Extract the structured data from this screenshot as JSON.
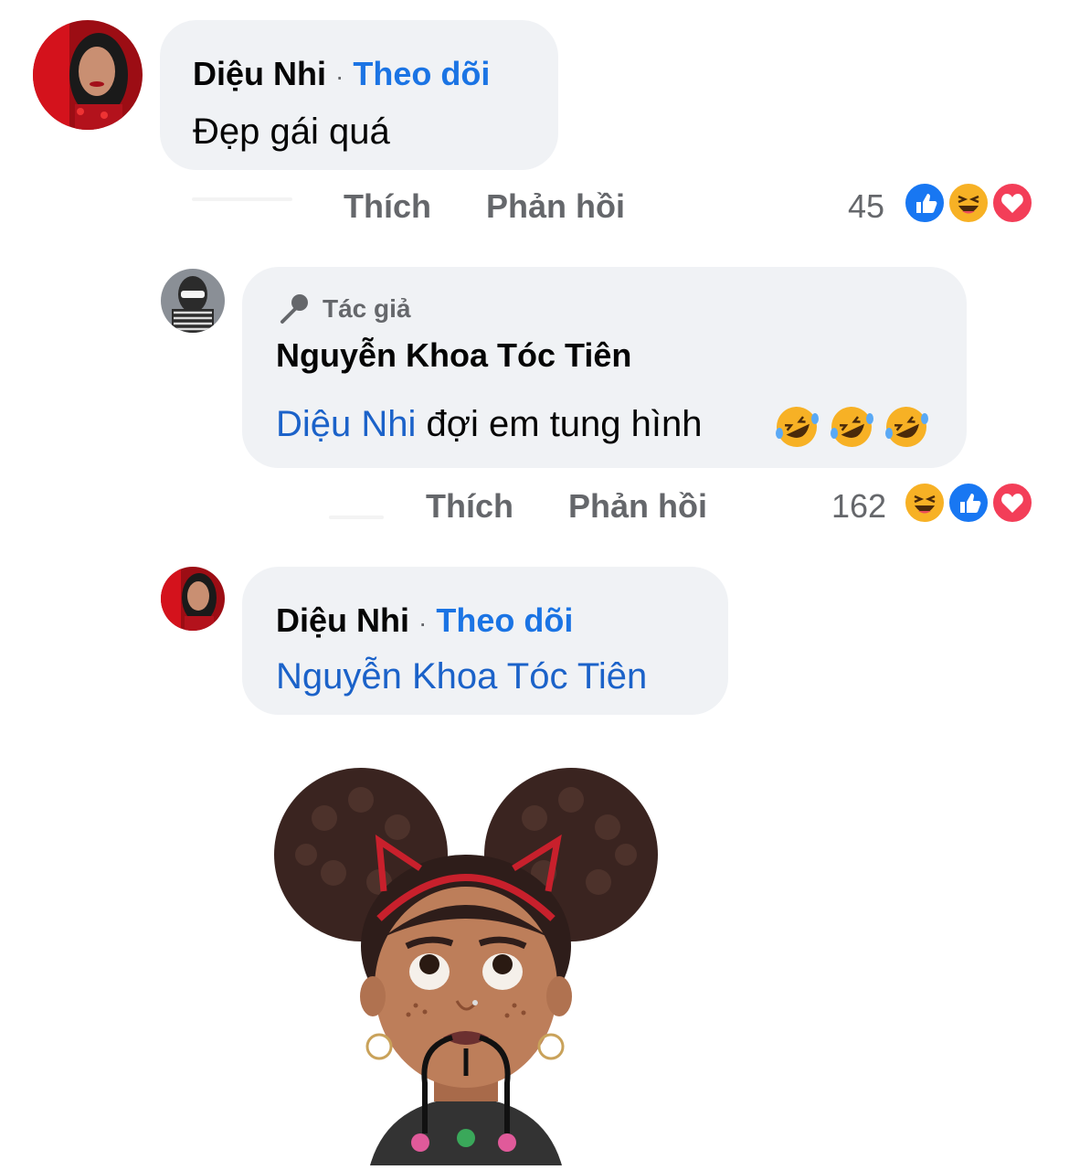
{
  "comments": [
    {
      "author": "Diệu Nhi",
      "dot": "·",
      "follow": "Theo dõi",
      "text": "Đẹp gái quá",
      "like": "Thích",
      "reply": "Phản hồi",
      "reaction_count": "45",
      "reactions": [
        "like-icon",
        "haha-icon",
        "love-icon"
      ]
    },
    {
      "badge": "Tác giả",
      "author": "Nguyễn Khoa Tóc Tiên",
      "mention": "Diệu Nhi",
      "text": "đợi em tung hình",
      "emojis": [
        "rofl-emoji",
        "rofl-emoji",
        "rofl-emoji"
      ],
      "like": "Thích",
      "reply": "Phản hồi",
      "reaction_count": "162",
      "reactions": [
        "haha-icon",
        "like-icon",
        "love-icon"
      ]
    },
    {
      "author": "Diệu Nhi",
      "dot": "·",
      "follow": "Theo dõi",
      "mention": "Nguyễn Khoa Tóc Tiên",
      "sticker": "memoji-sticker"
    }
  ],
  "colors": {
    "bubble": "#f0f2f5",
    "link": "#1b74e4",
    "muted": "#65676b",
    "like": "#1877f2",
    "love": "#f33e58",
    "haha": "#f7b125"
  }
}
